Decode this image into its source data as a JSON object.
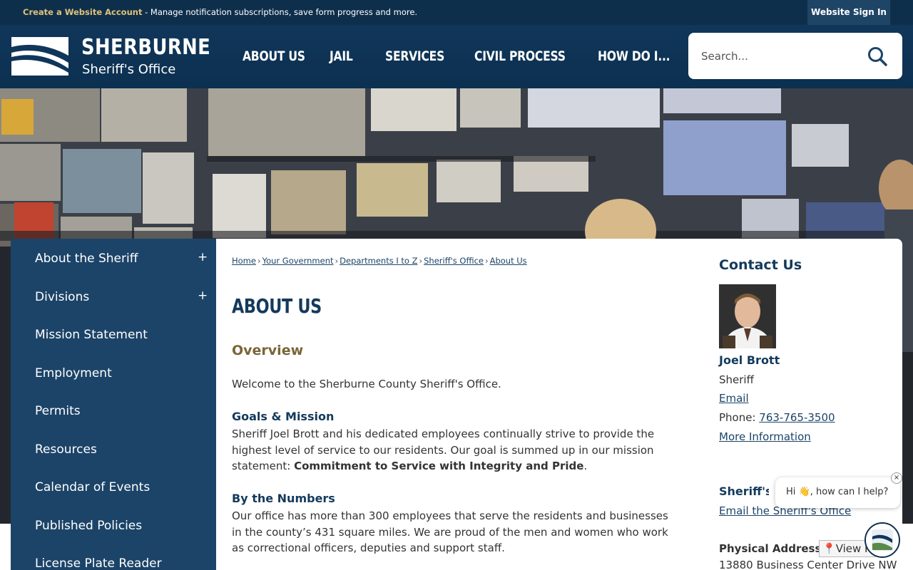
{
  "topbar": {
    "create_link": "Create a Website Account",
    "message": " - Manage notification subscriptions, save form progress and more.",
    "signin": "Website Sign In"
  },
  "header": {
    "logo_name": "SHERBURNE",
    "logo_sub": "Sheriff's Office",
    "nav": [
      "ABOUT US",
      "JAIL",
      "SERVICES",
      "CIVIL PROCESS",
      "HOW DO I..."
    ],
    "search_placeholder": "Search..."
  },
  "sidebar": {
    "items": [
      {
        "label": "About the Sheriff",
        "expandable": "+"
      },
      {
        "label": "Divisions",
        "expandable": "+"
      },
      {
        "label": "Mission Statement"
      },
      {
        "label": "Employment"
      },
      {
        "label": "Permits"
      },
      {
        "label": "Resources"
      },
      {
        "label": "Calendar of Events"
      },
      {
        "label": "Published Policies"
      },
      {
        "label": "License Plate Reader"
      }
    ]
  },
  "breadcrumb": [
    "Home",
    "Your Government",
    "Departments I to Z",
    "Sheriff's Office",
    "About Us"
  ],
  "main": {
    "title": "ABOUT US",
    "overview_heading": "Overview",
    "welcome": "Welcome to the Sherburne County Sheriff's Office.",
    "goals_heading": "Goals & Mission",
    "goals_text": "Sheriff Joel Brott and his dedicated employees continually strive to provide the highest level of service to our residents. Our goal is summed up in our mission statement: ",
    "goals_bold": "Commitment to Service with Integrity and Pride",
    "goals_end": ".",
    "numbers_heading": "By the Numbers",
    "numbers_text": "Our office has more than 300 employees that serve the residents and businesses in the county’s 431 square miles. We are proud of the men and women who work as correctional officers, deputies and support staff."
  },
  "contact": {
    "heading": "Contact Us",
    "name": "Joel Brott",
    "role": "Sheriff",
    "email": "Email",
    "phone_label": "Phone: ",
    "phone": "763-765-3500",
    "more": "More Information",
    "office_heading": "Sheriff's Office",
    "office_email": "Email the Sheriff's Office",
    "physical_heading": "Physical Address",
    "view_map": "View Map",
    "address": "13880 Business Center Drive NW"
  },
  "chat": {
    "greeting": "Hi 👋, how can I help?",
    "close": "×"
  },
  "colors": {
    "navy": "#0e2f4c",
    "sidebar": "#1c4468",
    "gold": "#7a6537",
    "accent": "#e0c27a"
  }
}
